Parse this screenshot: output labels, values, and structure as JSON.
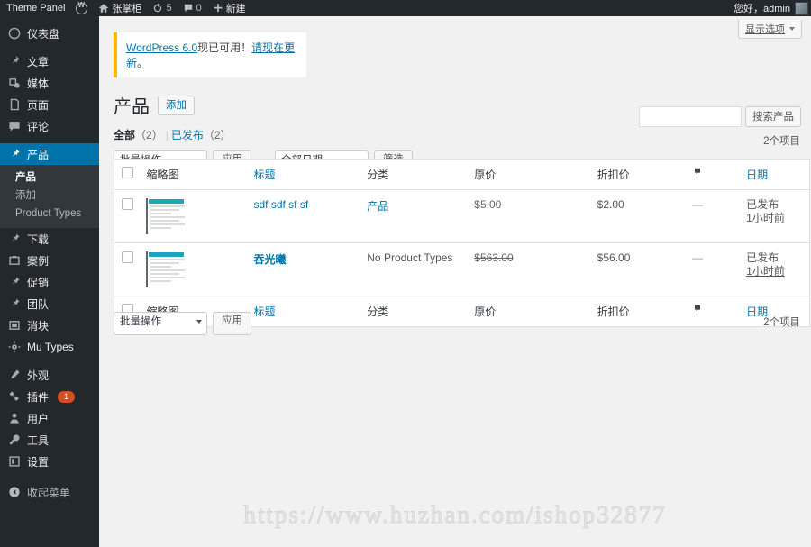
{
  "adminbar": {
    "theme_panel": "Theme Panel",
    "wp_logo_icon": "wordpress-logo-icon",
    "site_home_icon": "home-icon",
    "site_name": "张掌柜",
    "updates_icon": "updates-icon",
    "updates_count": "5",
    "comments_icon": "comment-icon",
    "comments_count": "0",
    "new_icon": "plus-icon",
    "new_label": "新建",
    "greeting": "您好，admin",
    "avatar_icon": "avatar"
  },
  "sidebar": {
    "items": [
      {
        "label": "仪表盘",
        "icon": "dashboard-icon",
        "active": false
      },
      {
        "label": "文章",
        "icon": "pin-icon",
        "active": false
      },
      {
        "label": "媒体",
        "icon": "media-icon",
        "active": false
      },
      {
        "label": "页面",
        "icon": "page-icon",
        "active": false
      },
      {
        "label": "评论",
        "icon": "comment-icon",
        "active": false
      },
      {
        "label": "产品",
        "icon": "pin-icon",
        "active": true
      },
      {
        "label": "下载",
        "icon": "pin-icon",
        "active": false
      },
      {
        "label": "案例",
        "icon": "case-icon",
        "active": false
      },
      {
        "label": "促销",
        "icon": "pin-icon",
        "active": false
      },
      {
        "label": "团队",
        "icon": "pin-icon",
        "active": false
      },
      {
        "label": "消块",
        "icon": "block-icon",
        "active": false
      },
      {
        "label": "Mu Types",
        "icon": "gear-icon",
        "active": false
      },
      {
        "label": "外观",
        "icon": "appearance-icon",
        "active": false
      },
      {
        "label": "插件",
        "icon": "plugin-icon",
        "active": false,
        "badge": "1"
      },
      {
        "label": "用户",
        "icon": "user-icon",
        "active": false
      },
      {
        "label": "工具",
        "icon": "tools-icon",
        "active": false
      },
      {
        "label": "设置",
        "icon": "settings-icon",
        "active": false
      }
    ],
    "submenu": [
      {
        "label": "产品",
        "current": true
      },
      {
        "label": "添加",
        "current": false
      },
      {
        "label": "Product Types",
        "current": false
      }
    ],
    "collapse_label": "收起菜单",
    "collapse_icon": "collapse-icon",
    "active_color": "#0073aa",
    "badge_color": "#d54e21"
  },
  "screen_options": {
    "label": "显示选项",
    "caret_icon": "chevron-down-icon"
  },
  "notice": {
    "link_text": "WordPress 6.0",
    "text_middle": "现已可用！",
    "link_update": "请现在更新",
    "text_end": "。",
    "accent_color": "#ffb900"
  },
  "page": {
    "title": "产品",
    "add_button": "添加"
  },
  "views": {
    "all_label": "全部",
    "all_count": "（2）",
    "divider": "|",
    "published_label": "已发布",
    "published_count": "（2）"
  },
  "tablenav_top": {
    "bulk_actions": "批量操作",
    "apply": "应用",
    "date_filter": "全部日期",
    "filter": "筛选"
  },
  "tablenav_bottom": {
    "bulk_actions": "批量操作",
    "apply": "应用"
  },
  "search": {
    "value": "",
    "placeholder": "",
    "button": "搜索产品",
    "icon": "search-icon"
  },
  "counts": {
    "top": "2个项目",
    "bottom": "2个项目"
  },
  "table": {
    "columns": {
      "checkbox": "select-all",
      "thumbnail": "缩略图",
      "title": "标题",
      "category": "分类",
      "price": "原价",
      "discount": "折扣价",
      "comments_icon": "comment-icon",
      "date": "日期"
    },
    "rows": [
      {
        "thumbnail": "product-thumbnail",
        "title": "sdf sdf sf sf",
        "title_bold": false,
        "category": "产品",
        "category_link": true,
        "price": "$5.00",
        "discount": "$2.00",
        "comments": "—",
        "status": "已发布",
        "date_ago": "1小时前"
      },
      {
        "thumbnail": "product-thumbnail",
        "title": "吞光曦",
        "title_bold": true,
        "category": "No Product Types",
        "category_link": false,
        "price": "$563.00",
        "discount": "$56.00",
        "comments": "—",
        "status": "已发布",
        "date_ago": "1小时前"
      }
    ]
  },
  "watermark": "https://www.huzhan.com/ishop32877"
}
